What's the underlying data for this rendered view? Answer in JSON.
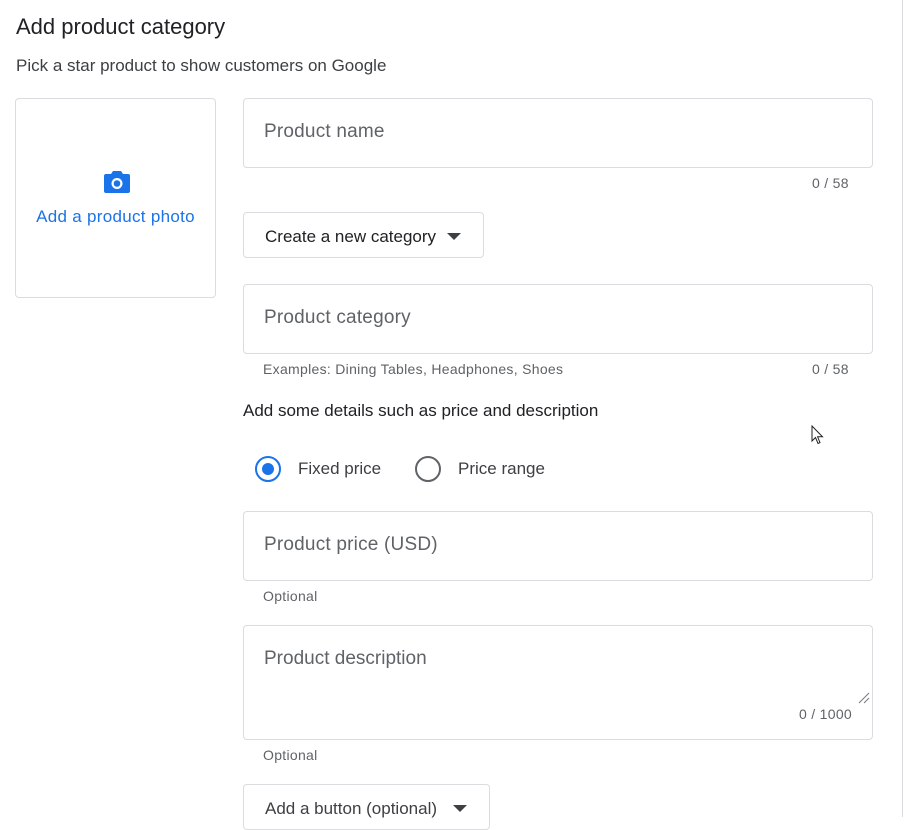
{
  "header": {
    "title": "Add product category",
    "subtitle": "Pick a star product to show customers on Google"
  },
  "photo": {
    "label": "Add a product photo",
    "icon": "camera-icon"
  },
  "product_name": {
    "placeholder": "Product name",
    "counter": "0 / 58"
  },
  "category_dropdown": {
    "label": "Create a new category"
  },
  "product_category": {
    "placeholder": "Product category",
    "helper": "Examples: Dining Tables, Headphones, Shoes",
    "counter": "0 / 58"
  },
  "details_heading": "Add some details such as price and description",
  "price_type": {
    "options": [
      {
        "label": "Fixed price",
        "selected": true
      },
      {
        "label": "Price range",
        "selected": false
      }
    ]
  },
  "product_price": {
    "placeholder": "Product price (USD)",
    "helper": "Optional"
  },
  "product_description": {
    "placeholder": "Product description",
    "counter": "0 / 1000",
    "helper": "Optional"
  },
  "button_dropdown": {
    "label": "Add a button (optional)"
  },
  "colors": {
    "accent": "#1a73e8",
    "border": "#dadce0",
    "muted": "#5f6368"
  }
}
